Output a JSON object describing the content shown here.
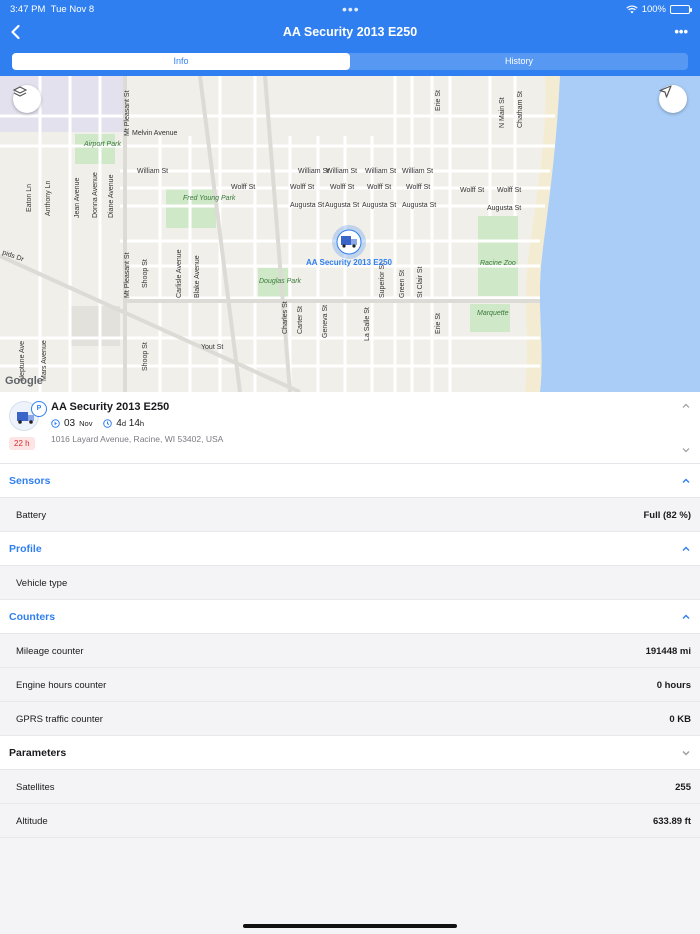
{
  "status_bar": {
    "time": "3:47 PM",
    "date": "Tue Nov 8",
    "battery": "100%",
    "dots": "•••"
  },
  "header": {
    "title": "AA Security 2013 E250",
    "more": "•••"
  },
  "tabs": [
    {
      "label": "Info",
      "active": true
    },
    {
      "label": "History",
      "active": false
    }
  ],
  "map": {
    "marker_label": "AA Security 2013 E250",
    "provider": "Google",
    "street_labels": [
      "Melvin Avenue",
      "William St",
      "Wolff St",
      "Augusta St",
      "Yout St",
      "Airport Park",
      "Fred Young Park",
      "Douglas Park",
      "Racine Zoo",
      "Marquette",
      "Erie St",
      "N Main St",
      "Chatham St",
      "Mt Pleasant St",
      "Jean Avenue",
      "Donna Avenue",
      "Diane Avenue",
      "Eaton Ln",
      "Anthony Ln",
      "Shoop St",
      "Carlisle Avenue",
      "Blake Avenue",
      "Charles St",
      "Carter St",
      "Geneva St",
      "La Salle St",
      "Superior St",
      "Green St",
      "St Clair St",
      "Neptune Ave",
      "Mars Avenue",
      "pids Dr"
    ]
  },
  "unit": {
    "name": "AA Security 2013 E250",
    "badge": "P",
    "age": "22 h",
    "date_day": "03",
    "date_month": "Nov",
    "duration_d_value": "4",
    "duration_d_unit": "d",
    "duration_h_value": "14",
    "duration_h_unit": "h",
    "address": "1016 Layard Avenue, Racine, WI 53402, USA"
  },
  "sections": {
    "sensors": {
      "title": "Sensors",
      "rows": [
        {
          "key": "Battery",
          "value": "Full (82 %)"
        }
      ]
    },
    "profile": {
      "title": "Profile",
      "rows": [
        {
          "key": "Vehicle type",
          "value": ""
        }
      ]
    },
    "counters": {
      "title": "Counters",
      "rows": [
        {
          "key": "Mileage counter",
          "value": "191448 mi"
        },
        {
          "key": "Engine hours counter",
          "value": "0 hours"
        },
        {
          "key": "GPRS traffic counter",
          "value": "0 KB"
        }
      ]
    },
    "parameters": {
      "title": "Parameters",
      "rows": [
        {
          "key": "Satellites",
          "value": "255"
        },
        {
          "key": "Altitude",
          "value": "633.89 ft"
        }
      ]
    }
  },
  "colors": {
    "accent": "#2f7ff0",
    "water": "#a9cdf7",
    "park": "#cfe8c8",
    "age_badge": "#d02c2c"
  }
}
